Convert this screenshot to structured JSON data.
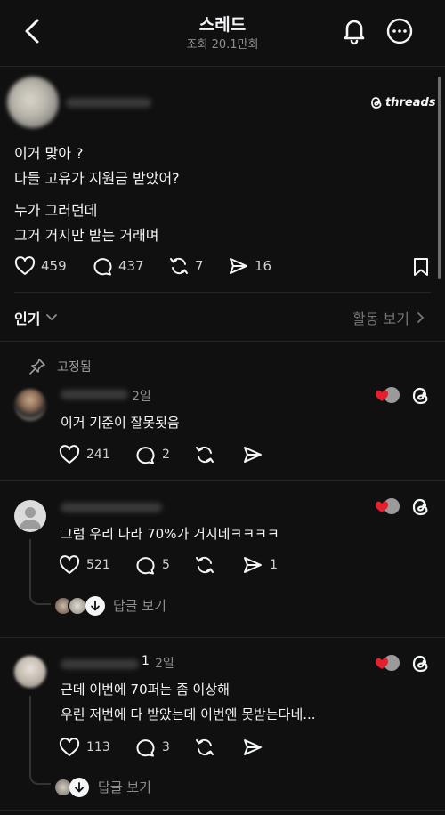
{
  "header": {
    "title": "스레드",
    "views": "조회 20.1만회"
  },
  "post": {
    "brand": "threads",
    "lines": [
      "이거 맞아 ?",
      "다들 고유가 지원금 받았어?",
      "누가 그러던데",
      "그거 거지만 받는 거래며"
    ],
    "likes": "459",
    "comments": "437",
    "reposts": "7",
    "shares": "16"
  },
  "sort": {
    "popular": "인기",
    "activity": "활동 보기"
  },
  "pinned_label": "고정됨",
  "comments": [
    {
      "time": "2일",
      "text": "이거 기준이 잘못됫음",
      "likes": "241",
      "replies": "2"
    },
    {
      "time": "",
      "text": "그럼 우리 나라 70%가 거지네ㅋㅋㅋㅋ",
      "likes": "521",
      "replies": "5",
      "shares": "1",
      "see_replies": "답글 보기"
    },
    {
      "name_suffix": "1",
      "time": "2일",
      "text1": "근데 이번에 70퍼는 좀 이상해",
      "text2": "우린 저번에 다 받았는데 이번엔 못받는다네...",
      "likes": "113",
      "replies": "3",
      "see_replies": "답글 보기"
    }
  ]
}
